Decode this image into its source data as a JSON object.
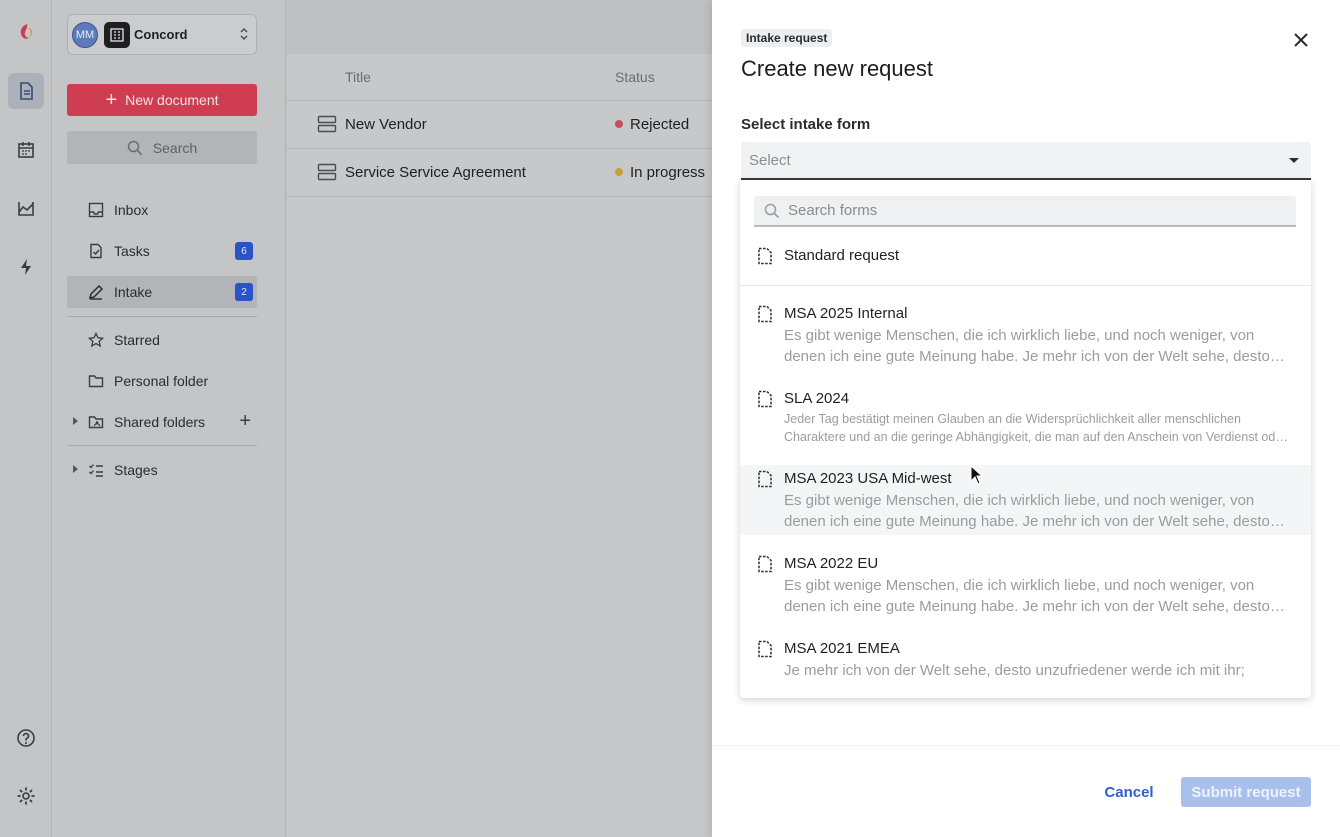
{
  "rail": {
    "icons": [
      "app-logo-icon",
      "documents-icon",
      "calendar-icon",
      "insights-icon",
      "automation-icon",
      "help-icon",
      "settings-icon"
    ]
  },
  "workspace": {
    "avatar_initials": "MM",
    "org_name": "Concord"
  },
  "sidebar": {
    "new_document_label": "New document",
    "search_label": "Search",
    "items": [
      {
        "label": "Inbox",
        "badge": ""
      },
      {
        "label": "Tasks",
        "badge": "6"
      },
      {
        "label": "Intake",
        "badge": "2"
      },
      {
        "label": "Starred",
        "badge": ""
      },
      {
        "label": "Personal folder",
        "badge": ""
      },
      {
        "label": "Shared folders",
        "badge": ""
      },
      {
        "label": "Stages",
        "badge": ""
      }
    ]
  },
  "table": {
    "headers": {
      "title": "Title",
      "status": "Status"
    },
    "rows": [
      {
        "title": "New Vendor",
        "status": "Rejected",
        "status_color": "#c5505f"
      },
      {
        "title": "Service Service Agreement",
        "status": "In progress",
        "status_color": "#c9a13a"
      }
    ]
  },
  "drawer": {
    "tag": "Intake request",
    "title": "Create new request",
    "form_label": "Select intake form",
    "select_placeholder": "Select",
    "search_placeholder": "Search forms",
    "options": [
      {
        "name": "Standard request",
        "description": ""
      },
      {
        "name": "MSA 2025 Internal",
        "description": "Es gibt wenige Menschen, die ich wirklich liebe, und noch weniger, von denen ich eine gute Meinung habe. Je mehr ich von der Welt sehe, desto unzufriedener werde ich mit ihr;"
      },
      {
        "name": "SLA 2024",
        "description": "Jeder Tag bestätigt meinen Glauben an die Widersprüchlichkeit aller menschlichen Charaktere und an die geringe Abhängigkeit, die man auf den Anschein von Verdienst oder Vernunft legen kann."
      },
      {
        "name": "MSA 2023 USA Mid-west",
        "description": "Es gibt wenige Menschen, die ich wirklich liebe, und noch weniger, von denen ich eine gute Meinung habe. Je mehr ich von der Welt sehe, desto unzufriedener werde ich mit ihr;"
      },
      {
        "name": "MSA 2022 EU",
        "description": "Es gibt wenige Menschen, die ich wirklich liebe, und noch weniger, von denen ich eine gute Meinung habe. Je mehr ich von der Welt sehe, desto unzufriedener werde ich mit ihr;"
      },
      {
        "name": "MSA 2021 EMEA",
        "description": "Je mehr ich von der Welt sehe, desto unzufriedener werde ich mit ihr;"
      }
    ],
    "cancel_label": "Cancel",
    "submit_label": "Submit request"
  },
  "colors": {
    "brand_red": "#cf3d52",
    "accent_blue": "#2f5fcf",
    "submit_disabled": "#a9c0ec"
  }
}
